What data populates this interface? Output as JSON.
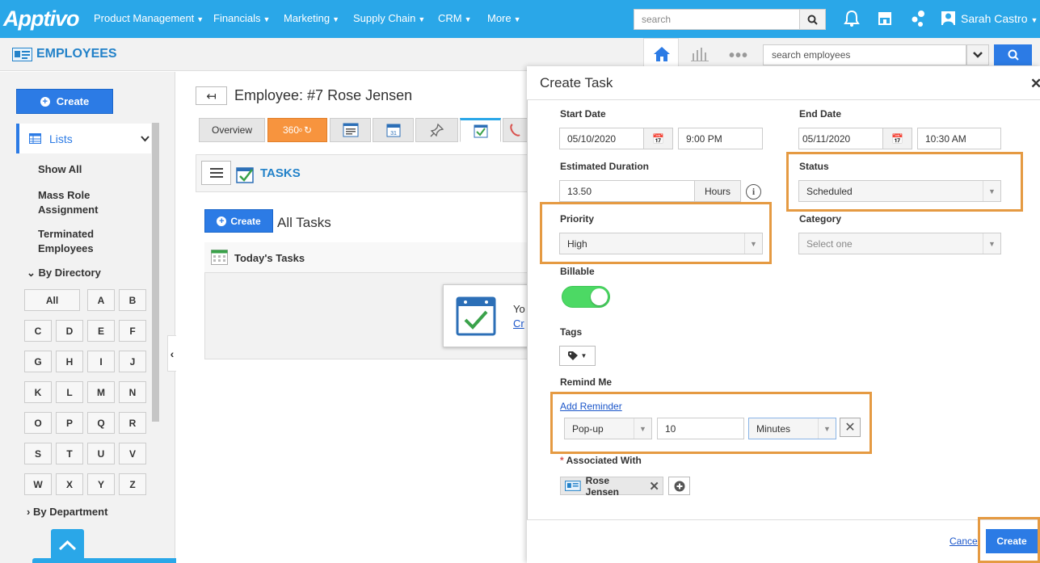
{
  "app": {
    "logo": "Apptivo",
    "user": "Sarah Castro",
    "search_placeholder": "search"
  },
  "nav": [
    "Product Management",
    "Financials",
    "Marketing",
    "Supply Chain",
    "CRM",
    "More"
  ],
  "subbar": {
    "title": "EMPLOYEES",
    "search_placeholder": "search employees"
  },
  "sidebar": {
    "create": "Create",
    "lists": "Lists",
    "links": [
      "Show All",
      "Mass Role Assignment",
      "Terminated Employees"
    ],
    "by_directory": "By Directory",
    "letters": [
      "All",
      "A",
      "B",
      "C",
      "D",
      "E",
      "F",
      "G",
      "H",
      "I",
      "J",
      "K",
      "L",
      "M",
      "N",
      "O",
      "P",
      "Q",
      "R",
      "S",
      "T",
      "U",
      "V",
      "W",
      "X",
      "Y",
      "Z"
    ],
    "by_department": "By Department"
  },
  "main": {
    "heading": "Employee: #7 Rose Jensen",
    "tab_overview": "Overview",
    "tab_360": "360",
    "tasks_title": "TASKS",
    "create": "Create",
    "all_tasks": "All Tasks",
    "todays_tasks": "Today's Tasks",
    "empty_text": "Yo",
    "empty_link": "Cr"
  },
  "modal": {
    "title": "Create Task",
    "start_date_label": "Start Date",
    "start_date": "05/10/2020",
    "start_time": "9:00 PM",
    "end_date_label": "End Date",
    "end_date": "05/11/2020",
    "end_time": "10:30 AM",
    "duration_label": "Estimated Duration",
    "duration": "13.50",
    "duration_unit": "Hours",
    "status_label": "Status",
    "status": "Scheduled",
    "priority_label": "Priority",
    "priority": "High",
    "category_label": "Category",
    "category": "Select one",
    "billable_label": "Billable",
    "billable_on": true,
    "tags_label": "Tags",
    "remind_label": "Remind Me",
    "add_reminder": "Add Reminder",
    "reminder_type": "Pop-up",
    "reminder_value": "10",
    "reminder_unit": "Minutes",
    "associated_label": "Associated With",
    "required_mark": "*",
    "associated_name": "Rose Jensen",
    "cancel": "Cancel",
    "create": "Create"
  },
  "colors": {
    "brand": "#2aa7e8",
    "primary_button": "#2c7be5",
    "highlight": "#e59a42",
    "toggle_on": "#4cd964"
  }
}
